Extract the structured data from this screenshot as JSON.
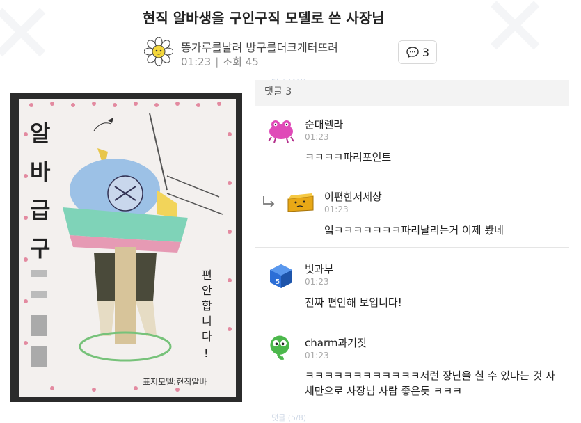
{
  "post": {
    "title": "현직 알바생을 구인구직 모델로 쓴 사장님",
    "author": "똥가루를날려 방구를더크게터뜨려",
    "time": "01:23",
    "views_label": "조회",
    "views": "45",
    "comment_count": "3"
  },
  "poster": {
    "vertical_title": [
      "알",
      "바",
      "급",
      "구"
    ],
    "side_text": [
      "편",
      "안",
      "합",
      "니",
      "다",
      "!"
    ],
    "footer": "표지모델:현직알바"
  },
  "comments": {
    "header": "댓글 3",
    "faded_top": "댓글 (4/4)",
    "faded_bottom": "댓글 (5/8)",
    "items": [
      {
        "name": "순대렐라",
        "time": "01:23",
        "text": "ㅋㅋㅋㅋ파리포인트",
        "reply": false
      },
      {
        "name": "이편한저세상",
        "time": "01:23",
        "text": "엌ㅋㅋㅋㅋㅋㅋㅋ파리날리는거 이제 봤네",
        "reply": true
      },
      {
        "name": "빗과부",
        "time": "01:23",
        "text": "진짜 편안해 보입니다!",
        "reply": false
      },
      {
        "name": "charm과거짓",
        "time": "01:23",
        "text": "ㅋㅋㅋㅋㅋㅋㅋㅋㅋㅋㅋㅋ저런 장난을 칠 수 있다는 것 자체만으로 사장님 사람 좋은듯 ㅋㅋㅋ",
        "reply": false
      }
    ]
  }
}
